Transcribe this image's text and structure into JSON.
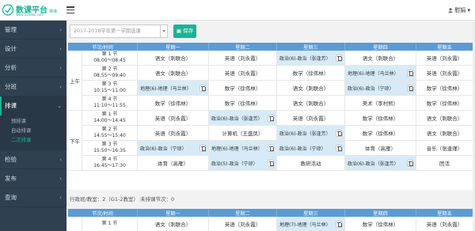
{
  "header": {
    "logo_text": "数课平台",
    "logo_badge": "排课",
    "logo_url": "www.51kebo.com",
    "user_name": "慰娟"
  },
  "sidebar": {
    "items": [
      {
        "label": "管理",
        "chevron": "‹"
      },
      {
        "label": "设计",
        "chevron": "‹"
      },
      {
        "label": "分析",
        "chevron": "‹"
      },
      {
        "label": "分班",
        "chevron": "‹"
      },
      {
        "label": "排课",
        "chevron": "⌄"
      },
      {
        "label": "检验",
        "chevron": "‹"
      },
      {
        "label": "发布",
        "chevron": "‹"
      },
      {
        "label": "查询",
        "chevron": "‹"
      }
    ],
    "sub_items": [
      "预排课",
      "自动排课",
      "二次排课"
    ]
  },
  "toolbar": {
    "semester_select": "2017-2018学年第一学期选课",
    "save_label": "保存"
  },
  "timetable": {
    "headers": [
      "节次/时间",
      "星期一",
      "星期二",
      "星期三",
      "星期四",
      "星期五"
    ],
    "segments": {
      "am": "上午",
      "pm": "下午"
    },
    "rows": [
      {
        "period": "第 1 节",
        "time": "08:00～08:45",
        "cells": [
          "语文（刺联合）",
          "英语（刘永霞）",
          "政治(6)-政治（张逢芳）",
          "语文（刺联合）",
          "英语（刘永霞）"
        ],
        "hl": [
          2
        ]
      },
      {
        "period": "第 2 节",
        "time": "08:55～09:40",
        "cells": [
          "语文（刺联合）",
          "英语（刘永霞）",
          "数学（徐伟林）",
          "地理(6)-地理（马兰林）",
          "英语（刘永霞）"
        ],
        "hl": [
          3
        ]
      },
      {
        "period": "第 3 节",
        "time": "10:15～11:00",
        "cells": [
          "地理(6)-地理（马兰林）",
          "数学（徐伟林）",
          "语文（刺联合）",
          "政治(6)-政治（宁琼）",
          "数学（徐伟林）"
        ],
        "hl": [
          0,
          3
        ]
      },
      {
        "period": "第 4 节",
        "time": "11:10～11:55",
        "cells": [
          "数学（徐伟林）",
          "数学（徐伟林）",
          "语文（刺联合）",
          "美术（李村熙）",
          "数学（徐伟林）"
        ],
        "hl": []
      },
      {
        "period": "第 1 节",
        "time": "14:00～14:45",
        "cells": [
          "英语（刘永霞）",
          "政治(6)-政治（张逢芳）",
          "英语（刘永霞）",
          "数学（徐伟林）",
          "语文（刺联合）"
        ],
        "hl": [
          1
        ]
      },
      {
        "period": "第 2 节",
        "time": "14:55～15:40",
        "cells": [
          "英语（刘永霞）",
          "计算机（王盛凤）",
          "政治(6)-政治（张逢芳）",
          "数学（徐伟林）",
          "语文（刺联合）"
        ],
        "hl": [
          2
        ]
      },
      {
        "period": "第 3 节",
        "time": "15:50～16:35",
        "cells": [
          "政治(6)-政治（宁琼）",
          "地理(6)-地理（马兰林）",
          "政治(6)-政治（宁琼）",
          "体育（高雁）",
          "音乐（张逢瑾）"
        ],
        "hl": [
          0,
          1,
          2
        ]
      },
      {
        "period": "第 4 节",
        "time": "16:45～17:30",
        "cells": [
          "体育（高雁）",
          "政治(5)-政治（宁琼）",
          "教研活动",
          "政治(6)-政治（张逢芳）",
          "团活"
        ],
        "hl": [
          1,
          3
        ]
      }
    ]
  },
  "info": "行政班/教室：2（G1-2教室） 未排课节次：0",
  "timetable2": {
    "headers": [
      "节次/时间",
      "星期一",
      "星期二",
      "星期三",
      "星期四",
      "星期五"
    ],
    "first_row": {
      "period": "第 1 节",
      "cells": [
        "语文（刺联合）",
        "英语（刘永霞）",
        "地理(7)-地理（马兰林）",
        "数学（徐伟林）",
        "英语（刘永霞）"
      ]
    }
  },
  "colors": {
    "accent": "#1ab394",
    "header_blue": "#5b9bd5",
    "sidebar": "#2f4050",
    "highlight": "#d6ebf7"
  }
}
